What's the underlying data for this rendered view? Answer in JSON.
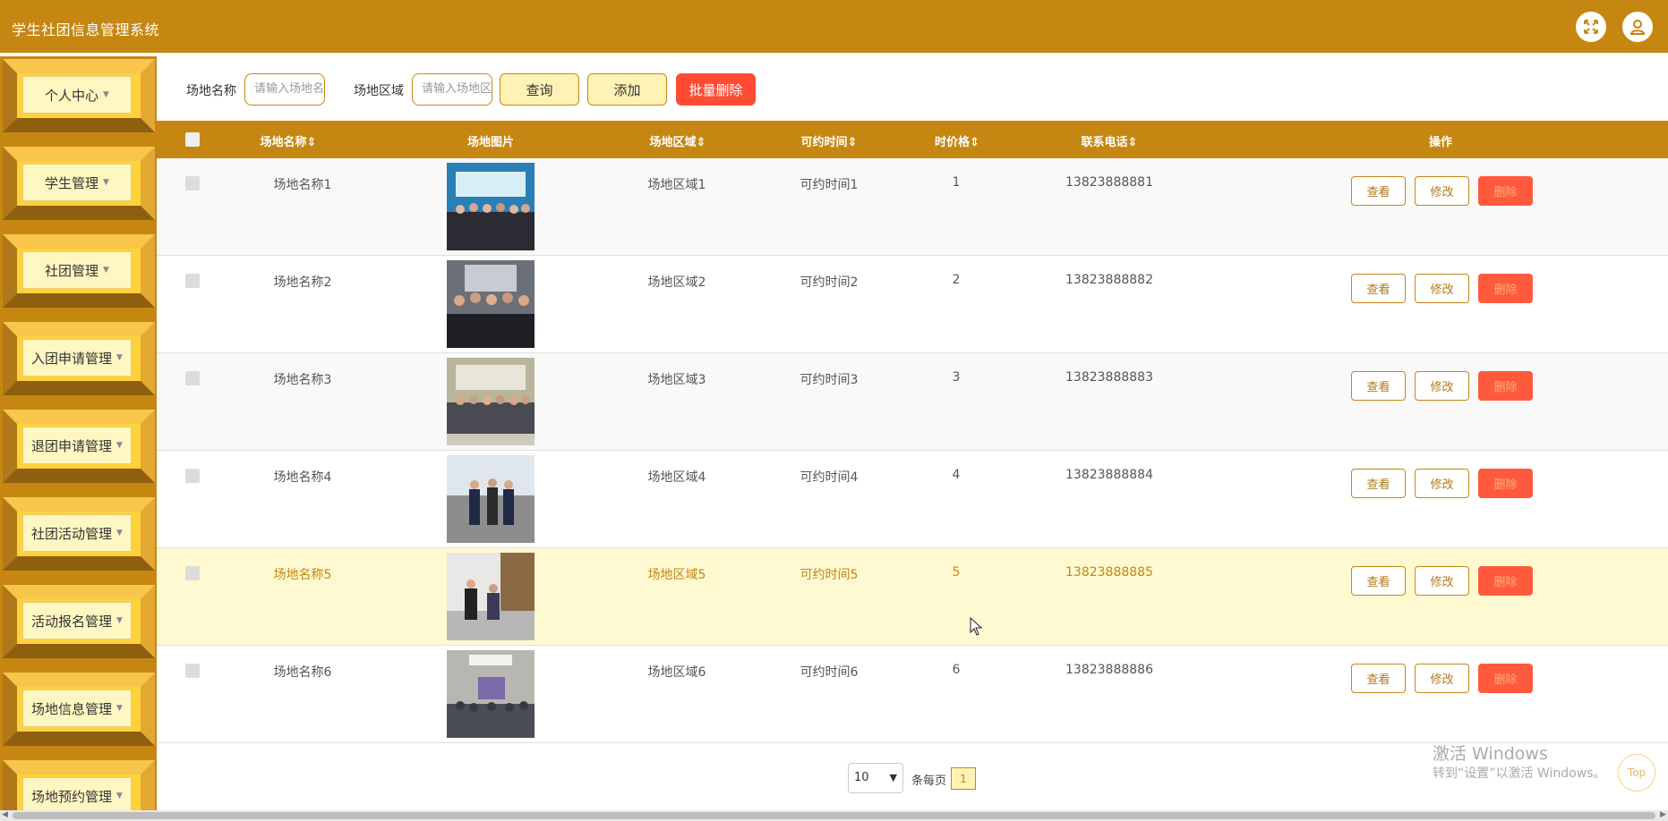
{
  "app": {
    "title": "学生社团信息管理系统",
    "accent_color": "#c58712",
    "header_icons": [
      "fullscreen-icon",
      "user-icon"
    ]
  },
  "sidebar": {
    "items": [
      {
        "label": "个人中心"
      },
      {
        "label": "学生管理"
      },
      {
        "label": "社团管理"
      },
      {
        "label": "入团申请管理"
      },
      {
        "label": "退团申请管理"
      },
      {
        "label": "社团活动管理"
      },
      {
        "label": "活动报名管理"
      },
      {
        "label": "场地信息管理"
      },
      {
        "label": "场地预约管理"
      }
    ]
  },
  "search": {
    "name_label": "场地名称",
    "name_placeholder": "请输入场地名称",
    "area_label": "场地区域",
    "area_placeholder": "请输入场地区域",
    "query_button": "查询",
    "add_button": "添加",
    "batch_delete_button": "批量删除"
  },
  "table": {
    "columns": [
      "场地名称",
      "场地图片",
      "场地区域",
      "可约时间",
      "时价格",
      "联系电话",
      "操作"
    ],
    "sort_marker": "⇕",
    "rows": [
      {
        "name": "场地名称1",
        "area": "场地区域1",
        "time": "可约时间1",
        "price": "1",
        "phone": "13823888881"
      },
      {
        "name": "场地名称2",
        "area": "场地区域2",
        "time": "可约时间2",
        "price": "2",
        "phone": "13823888882"
      },
      {
        "name": "场地名称3",
        "area": "场地区域3",
        "time": "可约时间3",
        "price": "3",
        "phone": "13823888883"
      },
      {
        "name": "场地名称4",
        "area": "场地区域4",
        "time": "可约时间4",
        "price": "4",
        "phone": "13823888884"
      },
      {
        "name": "场地名称5",
        "area": "场地区域5",
        "time": "可约时间5",
        "price": "5",
        "phone": "13823888885"
      },
      {
        "name": "场地名称6",
        "area": "场地区域6",
        "time": "可约时间6",
        "price": "6",
        "phone": "13823888886"
      }
    ],
    "actions": {
      "view": "查看",
      "edit": "修改",
      "delete": "删除"
    }
  },
  "pagination": {
    "page_size": "10",
    "page_size_label": "条每页",
    "current_page": "1"
  },
  "watermark": {
    "line1": "激活 Windows",
    "line2": "转到“设置”以激活 Windows。"
  },
  "top_button": "Top"
}
